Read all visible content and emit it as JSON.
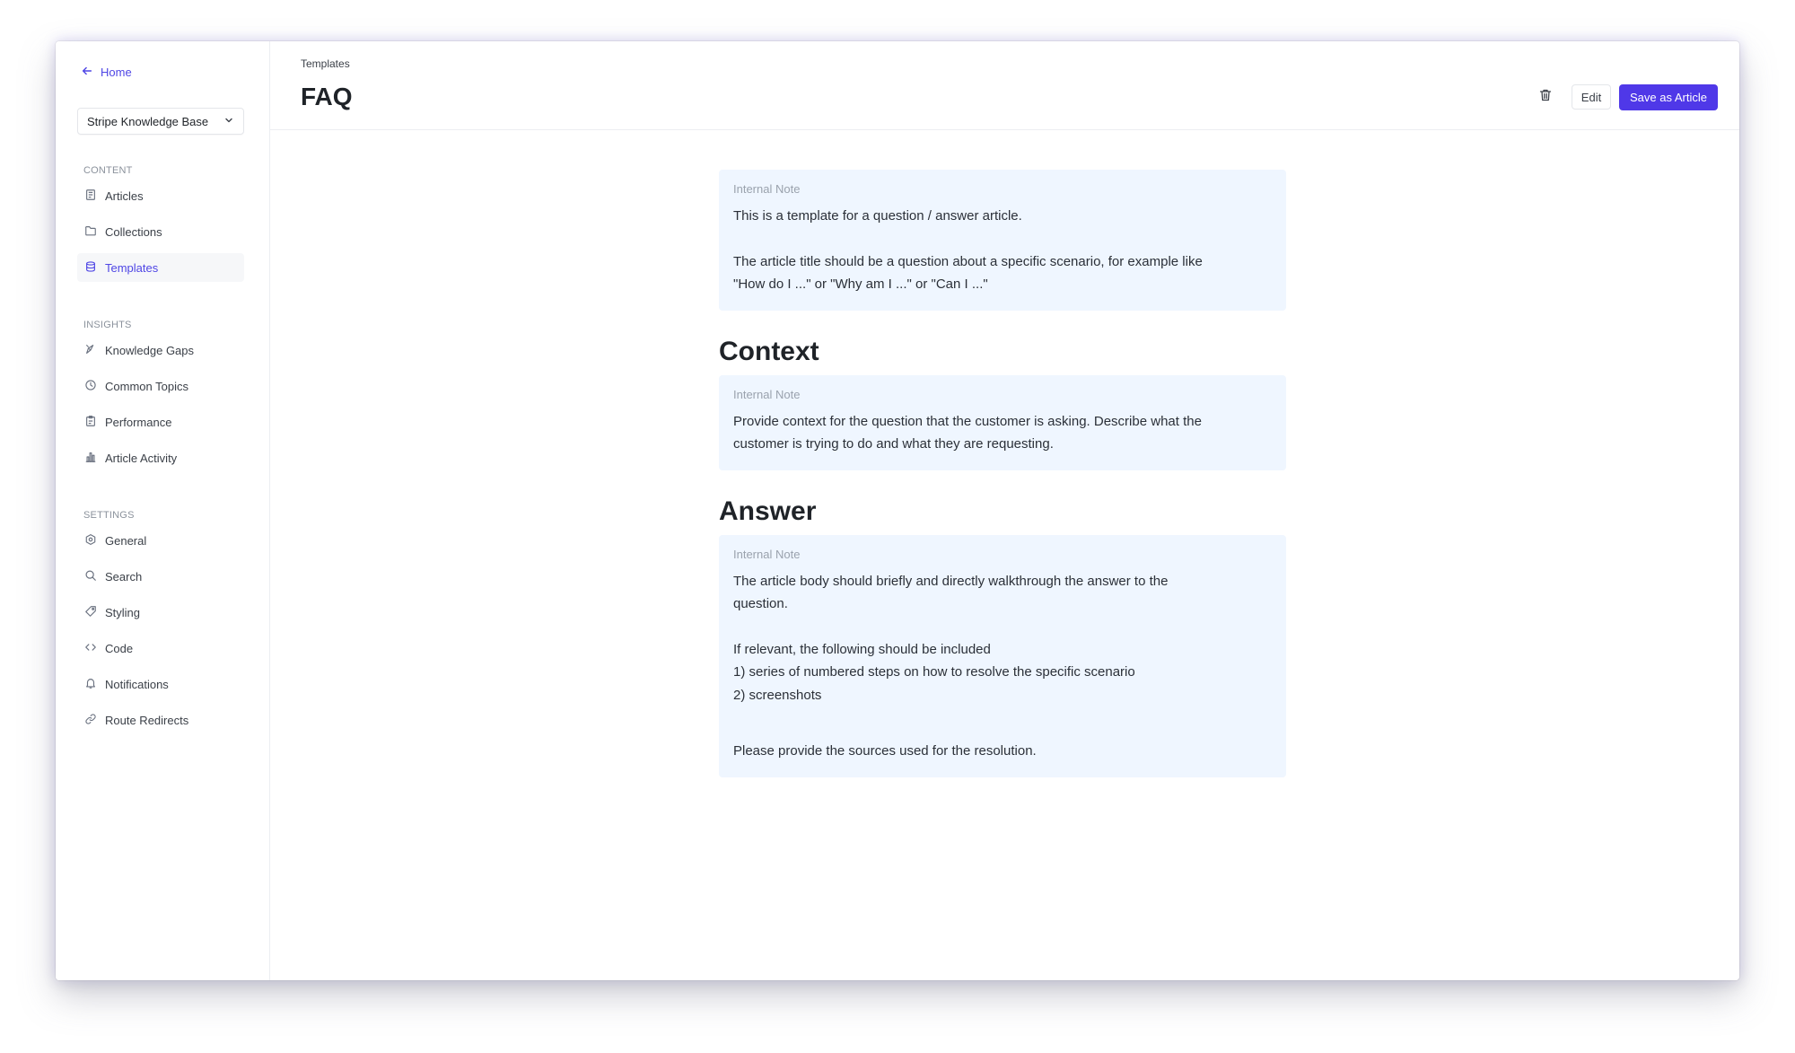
{
  "sidebar": {
    "home_label": "Home",
    "kb_selector": "Stripe Knowledge Base",
    "sections": {
      "content": "CONTENT",
      "insights": "INSIGHTS",
      "settings": "SETTINGS"
    },
    "content_items": [
      {
        "label": "Articles",
        "icon": "article-icon"
      },
      {
        "label": "Collections",
        "icon": "folder-icon"
      },
      {
        "label": "Templates",
        "icon": "stack-icon",
        "active": true
      }
    ],
    "insights_items": [
      {
        "label": "Knowledge Gaps",
        "icon": "pen-icon"
      },
      {
        "label": "Common Topics",
        "icon": "clock-icon"
      },
      {
        "label": "Performance",
        "icon": "clipboard-icon"
      },
      {
        "label": "Article Activity",
        "icon": "bar-chart-icon"
      }
    ],
    "settings_items": [
      {
        "label": "General",
        "icon": "gear-icon"
      },
      {
        "label": "Search",
        "icon": "search-icon"
      },
      {
        "label": "Styling",
        "icon": "tag-icon"
      },
      {
        "label": "Code",
        "icon": "code-icon"
      },
      {
        "label": "Notifications",
        "icon": "bell-icon"
      },
      {
        "label": "Route Redirects",
        "icon": "link-icon"
      }
    ]
  },
  "header": {
    "breadcrumb": "Templates",
    "title": "FAQ",
    "edit_label": "Edit",
    "save_label": "Save as Article"
  },
  "colors": {
    "accent": "#4f46e5",
    "primary_button": "#4f38e8",
    "note_background": "#eff6ff"
  },
  "article": {
    "intro_note": {
      "label": "Internal Note",
      "line1": "This is a template for a question / answer article.",
      "line2": "The article title should be a question about a specific scenario, for example like",
      "line3": "\"How do I ...\" or \"Why am I ...\" or \"Can I ...\""
    },
    "context_heading": "Context",
    "context_note": {
      "label": "Internal Note",
      "line1": "Provide context for the question that the customer is asking. Describe what the",
      "line2": "customer is trying to do and what they are requesting."
    },
    "answer_heading": "Answer",
    "answer_note": {
      "label": "Internal Note",
      "line1": "The article body should briefly and directly walkthrough the answer to the",
      "line2": "question.",
      "line3": "If relevant, the following should be included",
      "line4": "1) series of numbered steps on how to resolve the specific scenario",
      "line5": "2) screenshots",
      "line6": "Please provide the sources used for the resolution."
    }
  }
}
